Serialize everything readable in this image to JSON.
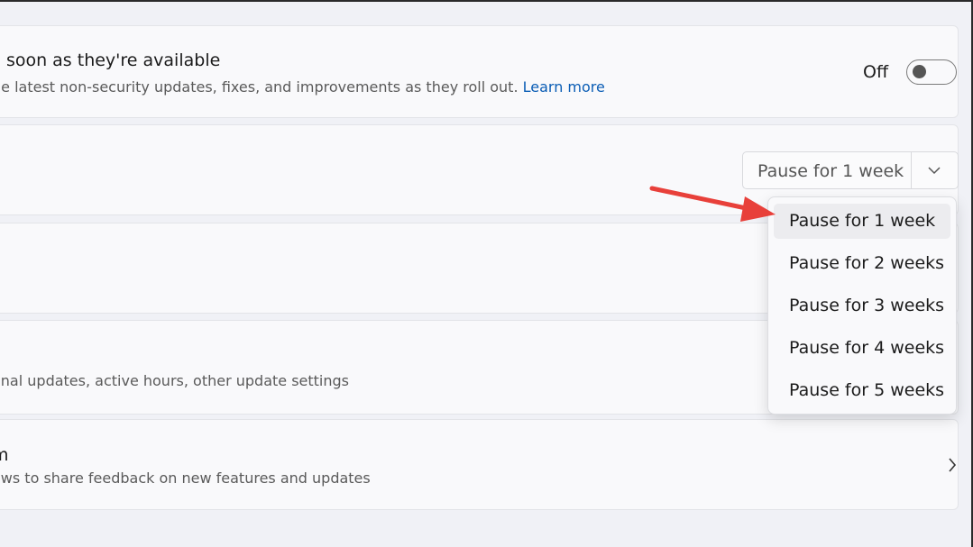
{
  "updates_asap": {
    "title": "s soon as they're available",
    "description": "he latest non-security updates, fixes, and improvements as they roll out.",
    "learn_more": "Learn more",
    "toggle_state": "Off"
  },
  "pause_updates": {
    "selected_label": "Pause for 1 week",
    "menu_items": [
      "Pause for 1 week",
      "Pause for 2 weeks",
      "Pause for 3 weeks",
      "Pause for 4 weeks",
      "Pause for 5 weeks"
    ]
  },
  "advanced_options": {
    "description": "onal updates, active hours, other update settings"
  },
  "insider_program": {
    "title": "m",
    "description": "ows to share feedback on new features and updates"
  },
  "colors": {
    "link": "#0a5db5",
    "annotation_arrow": "#e8403a",
    "menu_selected": "#ececef"
  }
}
